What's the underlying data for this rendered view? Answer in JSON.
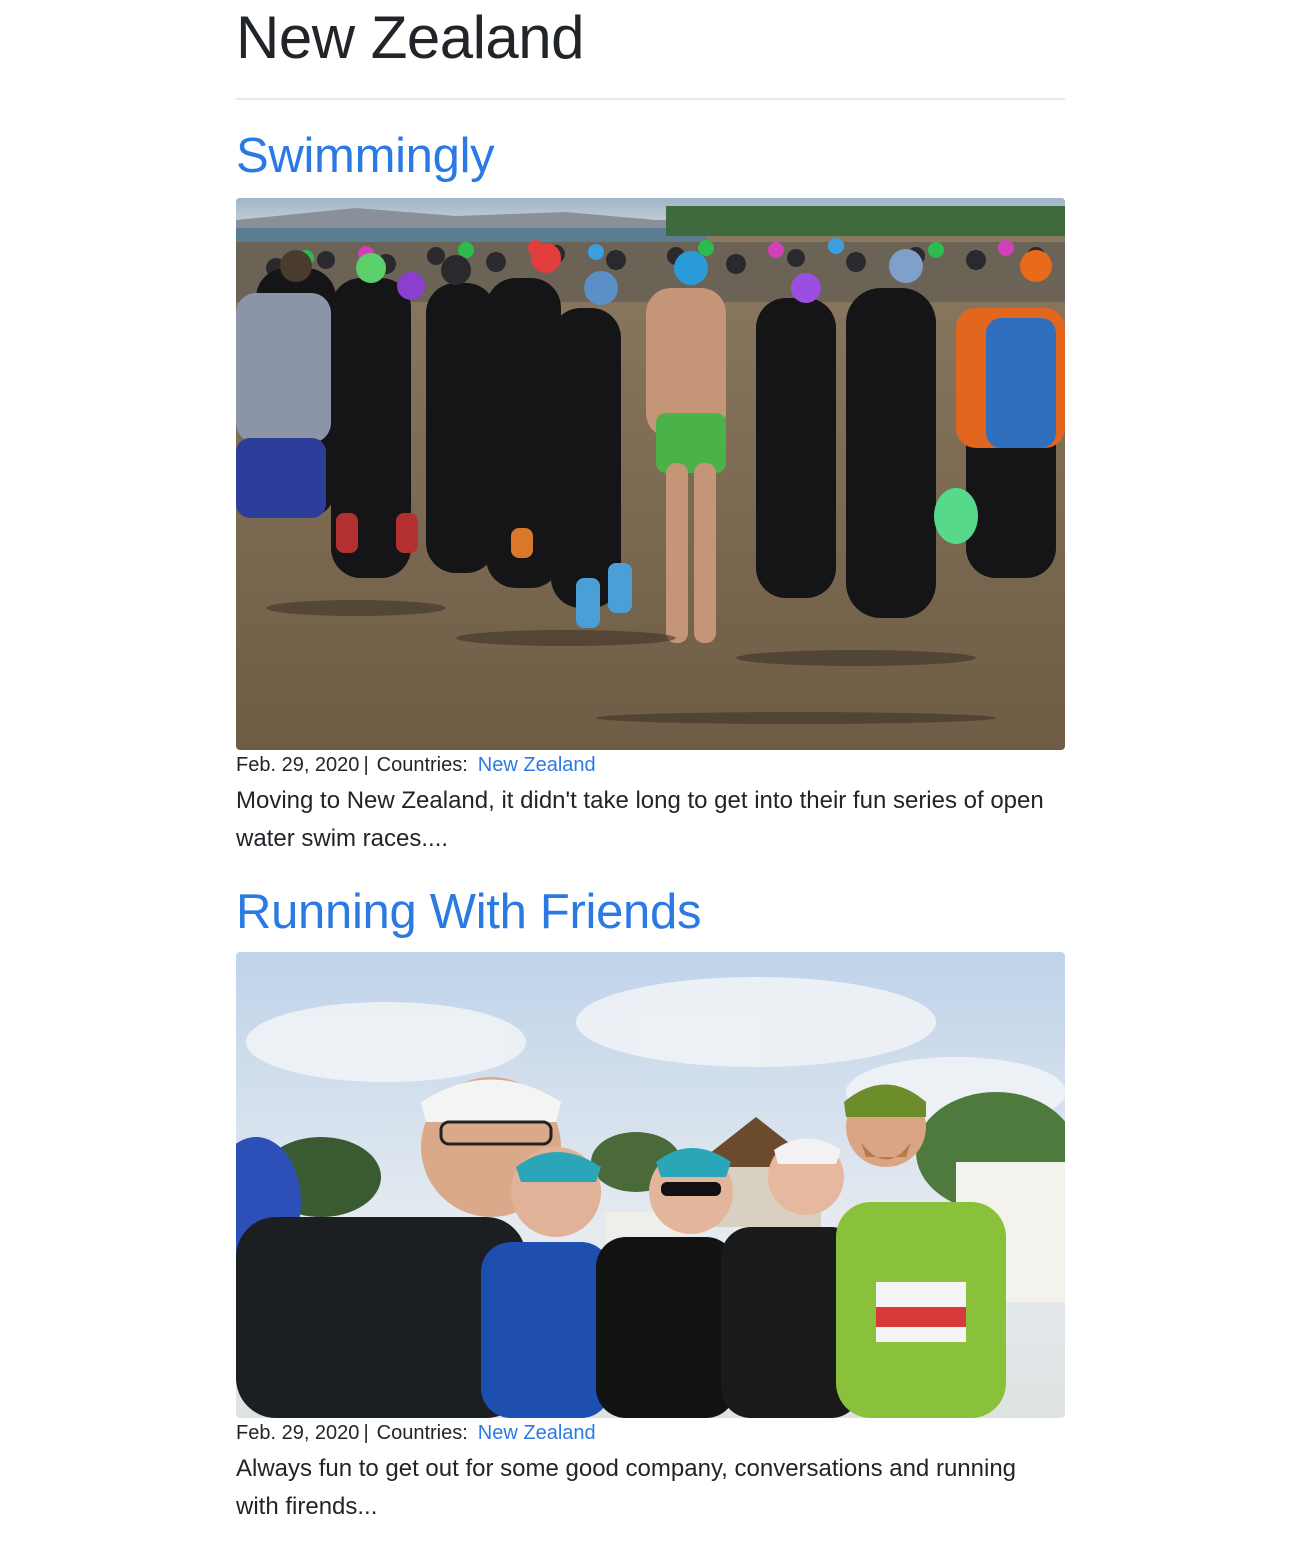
{
  "page": {
    "title": "New Zealand"
  },
  "posts": [
    {
      "title": "Swimmingly",
      "date": "Feb. 29, 2020",
      "separator": "|",
      "countries_label": "Countries:",
      "country": "New Zealand",
      "excerpt": "Moving to New Zealand, it didn't take long to get into their fun series of open water swim races...."
    },
    {
      "title": "Running With Friends",
      "date": "Feb. 29, 2020",
      "separator": "|",
      "countries_label": "Countries:",
      "country": "New Zealand",
      "excerpt": "Always fun to get out for some good company, conversations and running with firends..."
    }
  ],
  "colors": {
    "link": "#2b7ae4",
    "text": "#212529",
    "divider": "#e5e7e9"
  }
}
